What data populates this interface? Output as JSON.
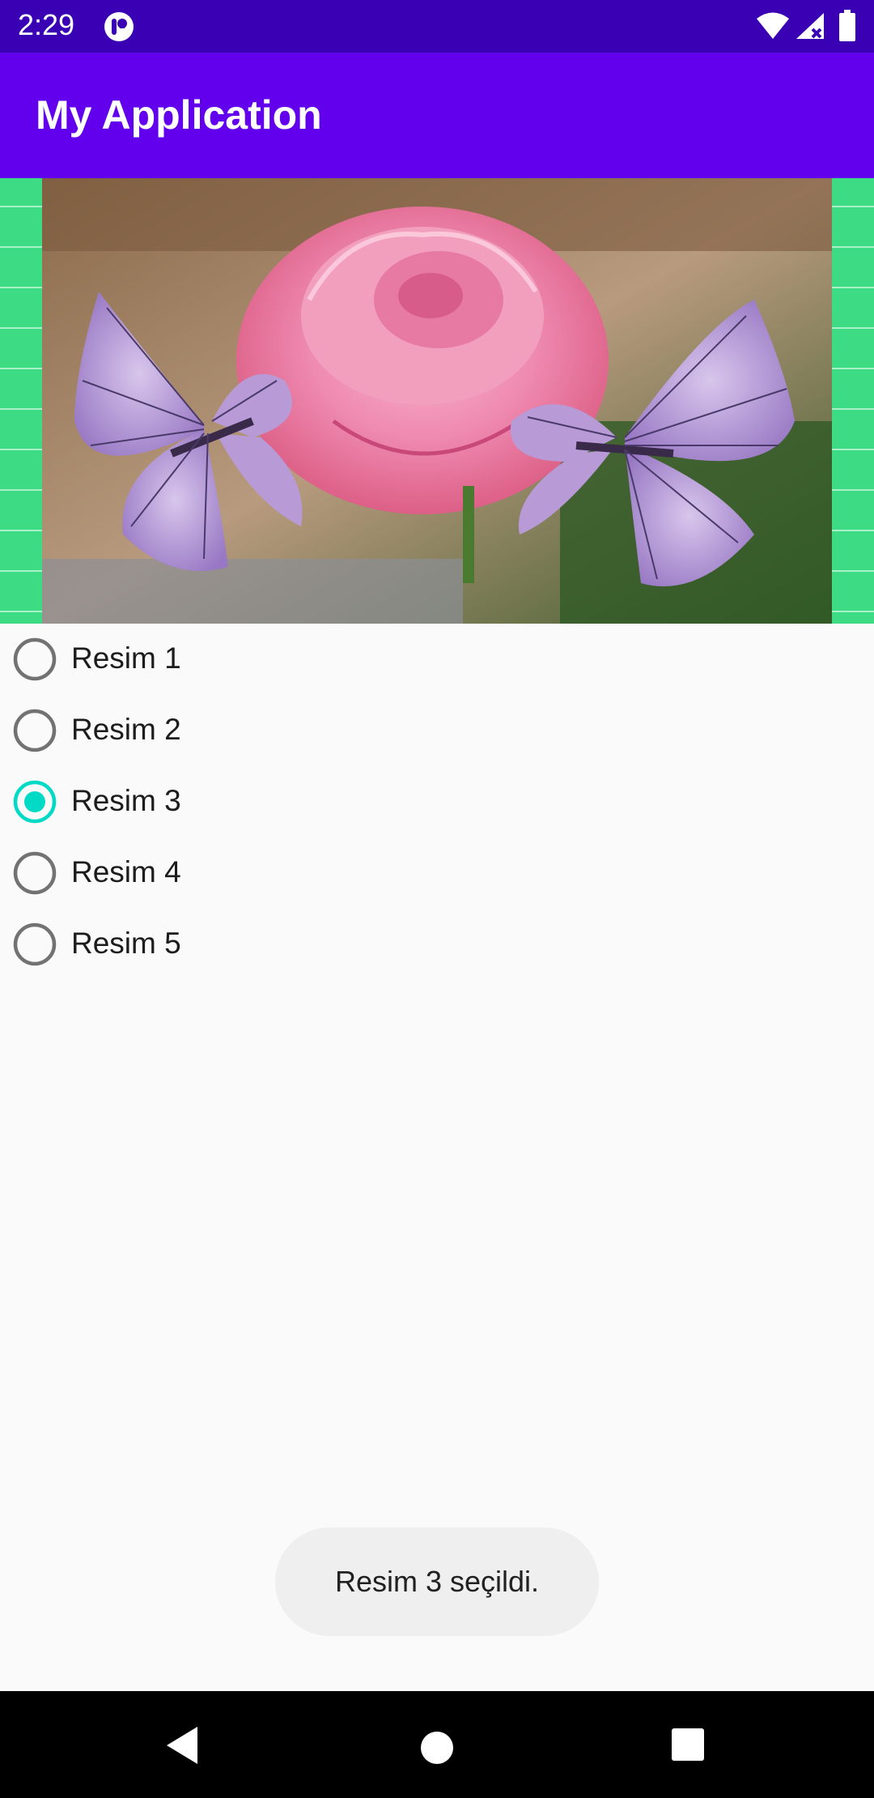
{
  "status_bar": {
    "time": "2:29",
    "icons": [
      "notification-icon",
      "wifi-icon",
      "cell-signal-icon",
      "battery-icon"
    ]
  },
  "app_bar": {
    "title": "My Application",
    "color": "#6200ee"
  },
  "image": {
    "description_icon": "rose-butterflies-image",
    "background_color": "#3ddc84"
  },
  "radio_group": {
    "selected_index": 2,
    "accent_color": "#03dac5",
    "items": [
      {
        "label": "Resim 1",
        "checked": false
      },
      {
        "label": "Resim 2",
        "checked": false
      },
      {
        "label": "Resim 3",
        "checked": true
      },
      {
        "label": "Resim 4",
        "checked": false
      },
      {
        "label": "Resim 5",
        "checked": false
      }
    ]
  },
  "toast": {
    "text": "Resim 3 seçildi."
  },
  "nav_bar": {
    "icons": [
      "back-icon",
      "home-icon",
      "recents-icon"
    ]
  }
}
